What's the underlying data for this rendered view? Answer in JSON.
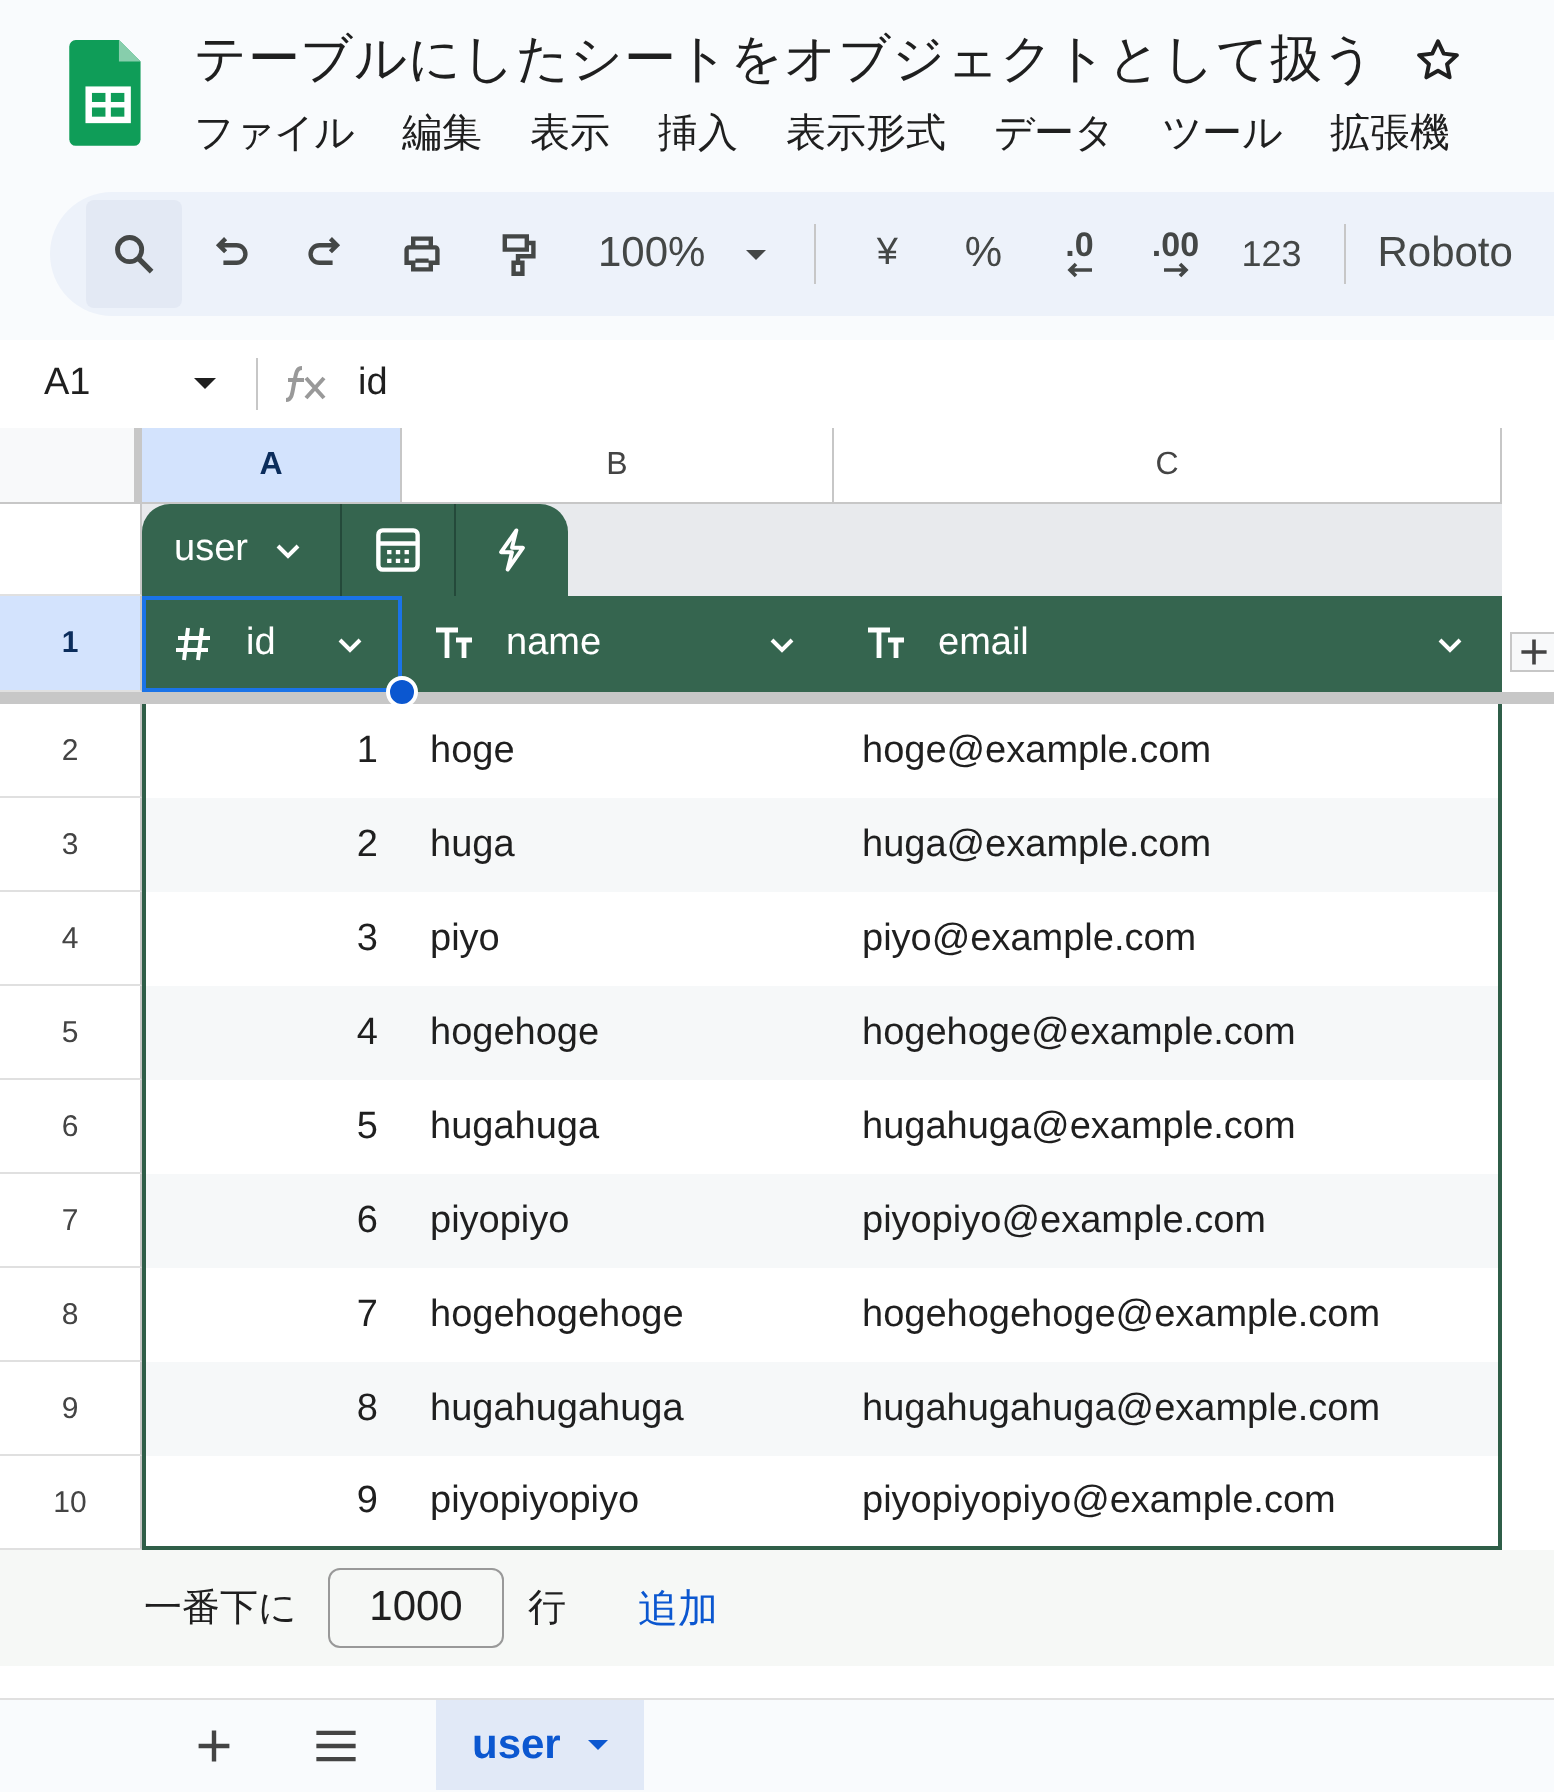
{
  "document": {
    "title": "テーブルにしたシートをオブジェクトとして扱う"
  },
  "menu": [
    "ファイル",
    "編集",
    "表示",
    "挿入",
    "表示形式",
    "データ",
    "ツール",
    "拡張機"
  ],
  "toolbar": {
    "zoom": "100%",
    "currency": "¥",
    "percent": "%",
    "decrease_decimals": ".0",
    "increase_decimals": ".00",
    "number_format": "123",
    "font": "Roboto"
  },
  "formula_bar": {
    "cell_ref": "A1",
    "formula": "id"
  },
  "columns": [
    {
      "label": "A",
      "selected": true
    },
    {
      "label": "B",
      "selected": false
    },
    {
      "label": "C",
      "selected": false
    }
  ],
  "row_headers": [
    {
      "label": "1",
      "selected": true
    },
    {
      "label": "2",
      "selected": false
    },
    {
      "label": "3",
      "selected": false
    },
    {
      "label": "4",
      "selected": false
    },
    {
      "label": "5",
      "selected": false
    },
    {
      "label": "6",
      "selected": false
    },
    {
      "label": "7",
      "selected": false
    },
    {
      "label": "8",
      "selected": false
    },
    {
      "label": "9",
      "selected": false
    },
    {
      "label": "10",
      "selected": false
    }
  ],
  "table": {
    "name": "user",
    "fields": [
      {
        "kind": "number",
        "name": "id",
        "selected": true
      },
      {
        "kind": "text",
        "name": "name",
        "selected": false
      },
      {
        "kind": "text",
        "name": "email",
        "selected": false
      }
    ],
    "rows": [
      {
        "id": "1",
        "name": "hoge",
        "email": "hoge@example.com"
      },
      {
        "id": "2",
        "name": "huga",
        "email": "huga@example.com"
      },
      {
        "id": "3",
        "name": "piyo",
        "email": "piyo@example.com"
      },
      {
        "id": "4",
        "name": "hogehoge",
        "email": "hogehoge@example.com"
      },
      {
        "id": "5",
        "name": "hugahuga",
        "email": "hugahuga@example.com"
      },
      {
        "id": "6",
        "name": "piyopiyo",
        "email": "piyopiyo@example.com"
      },
      {
        "id": "7",
        "name": "hogehogehoge",
        "email": "hogehogehoge@example.com"
      },
      {
        "id": "8",
        "name": "hugahugahuga",
        "email": "hugahugahuga@example.com"
      },
      {
        "id": "9",
        "name": "piyopiyopiyo",
        "email": "piyopiyopiyo@example.com"
      }
    ]
  },
  "add_rows": {
    "prefix": "一番下に",
    "count": "1000",
    "unit": "行",
    "button": "追加"
  },
  "sheets": [
    {
      "name": "user",
      "selected": true
    }
  ]
}
